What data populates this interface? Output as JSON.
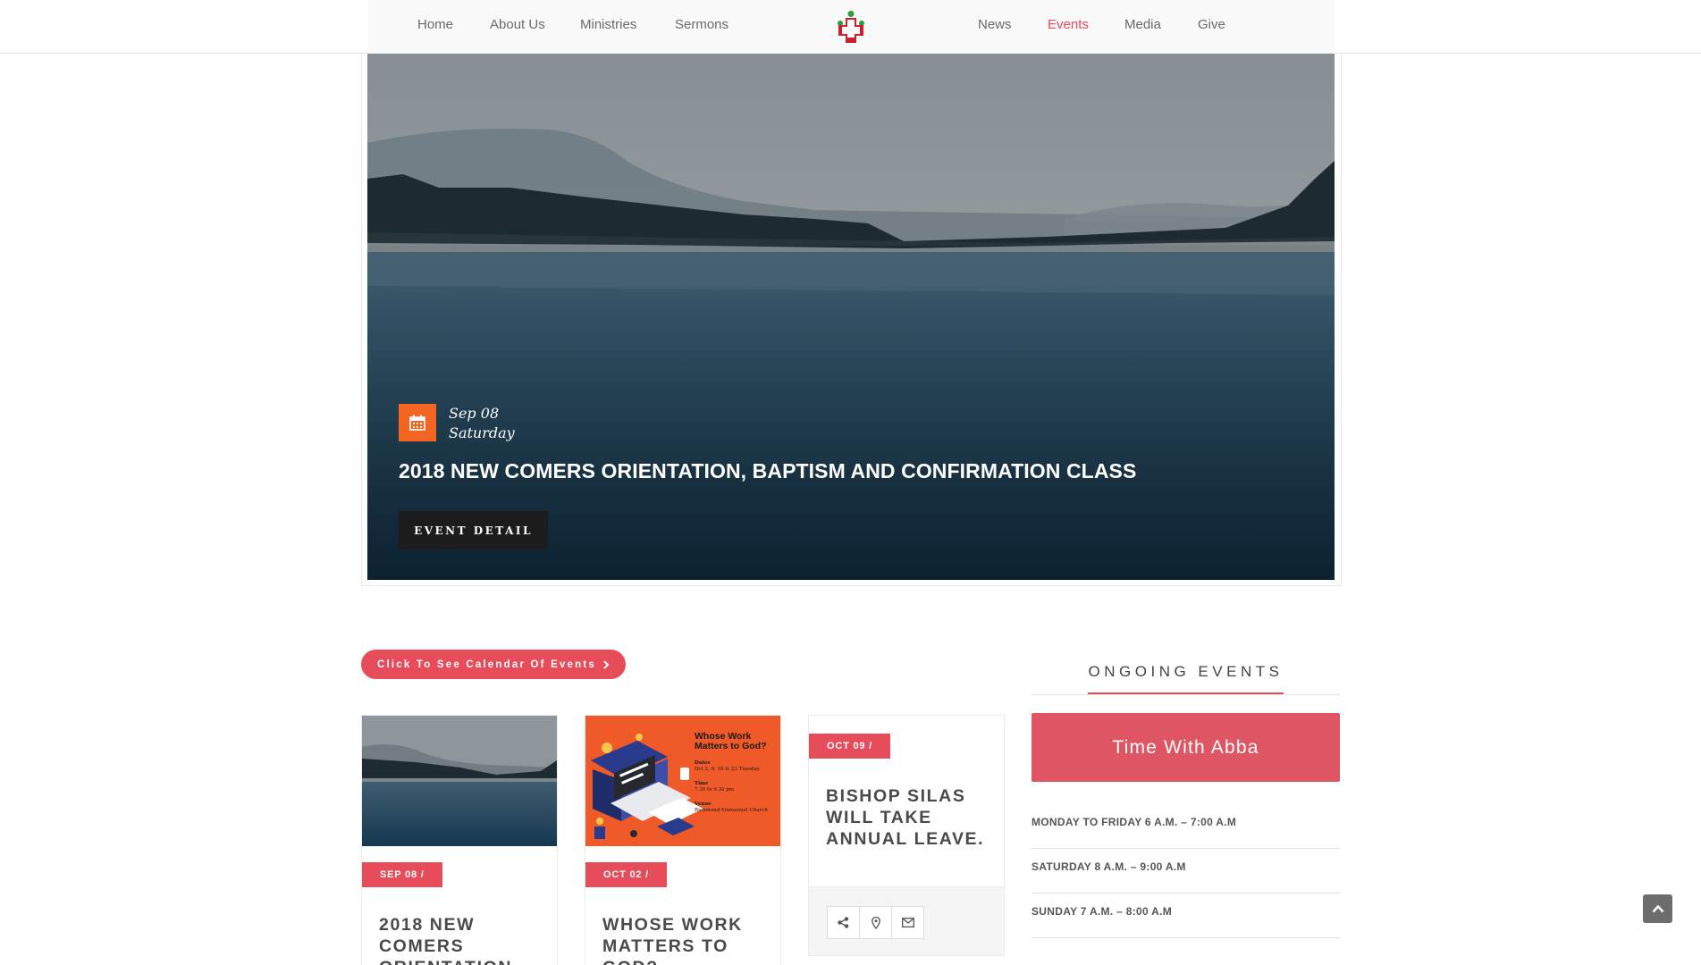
{
  "nav": {
    "items_left": [
      {
        "label": "Home"
      },
      {
        "label": "About Us"
      },
      {
        "label": "Ministries"
      },
      {
        "label": "Sermons"
      }
    ],
    "items_right": [
      {
        "label": "News"
      },
      {
        "label": "Events",
        "active": true
      },
      {
        "label": "Media"
      },
      {
        "label": "Give"
      }
    ]
  },
  "hero": {
    "date": "Sep 08",
    "day": "Saturday",
    "title": "2018 NEW COMERS ORIENTATION, BAPTISM AND CONFIRMATION CLASS",
    "button_label": "EVENT DETAIL"
  },
  "calendar_button": {
    "label": "Click To See Calendar Of Events"
  },
  "events": [
    {
      "badge": "SEP 08 /",
      "title_lines": [
        "2018 NEW",
        "COMERS",
        "ORIENTATION,"
      ]
    },
    {
      "badge": "OCT 02 /",
      "title_lines": [
        "WHOSE WORK",
        "MATTERS TO",
        "GOD?"
      ],
      "poster": {
        "heading": "Whose Work Matters to God?",
        "dates_label": "Dates",
        "dates": "Oct 2, 9, 16 & 23 Tuesday",
        "time_label": "Time",
        "time": "7.30 to 9.30 pm",
        "venue_label": "Venue",
        "venue": "Richmond Emmanuel Church"
      }
    },
    {
      "badge": "OCT 09 /",
      "title_lines": [
        "BISHOP SILAS",
        "WILL TAKE",
        "ANNUAL LEAVE."
      ]
    }
  ],
  "sidebar": {
    "heading": "ONGOING EVENTS",
    "featured_label": "Time With Abba",
    "schedule": [
      {
        "text": "MONDAY TO FRIDAY 6 A.M. – 7:00 A.M"
      },
      {
        "text": "SATURDAY 8 A.M. – 9:00 A.M"
      },
      {
        "text": "SUNDAY 7 A.M. – 8:00 A.M"
      }
    ]
  },
  "icons": {
    "calendar": "calendar-icon",
    "chevron": "chevron-right-icon",
    "share": "share-icon",
    "location": "map-pin-icon",
    "email": "envelope-icon",
    "to_top": "chevron-up-icon"
  },
  "colors": {
    "accent": "#e64c5a",
    "date_icon_bg": "#f26522",
    "dark_button": "#1c1c1c",
    "poster_orange": "#f05a28"
  }
}
